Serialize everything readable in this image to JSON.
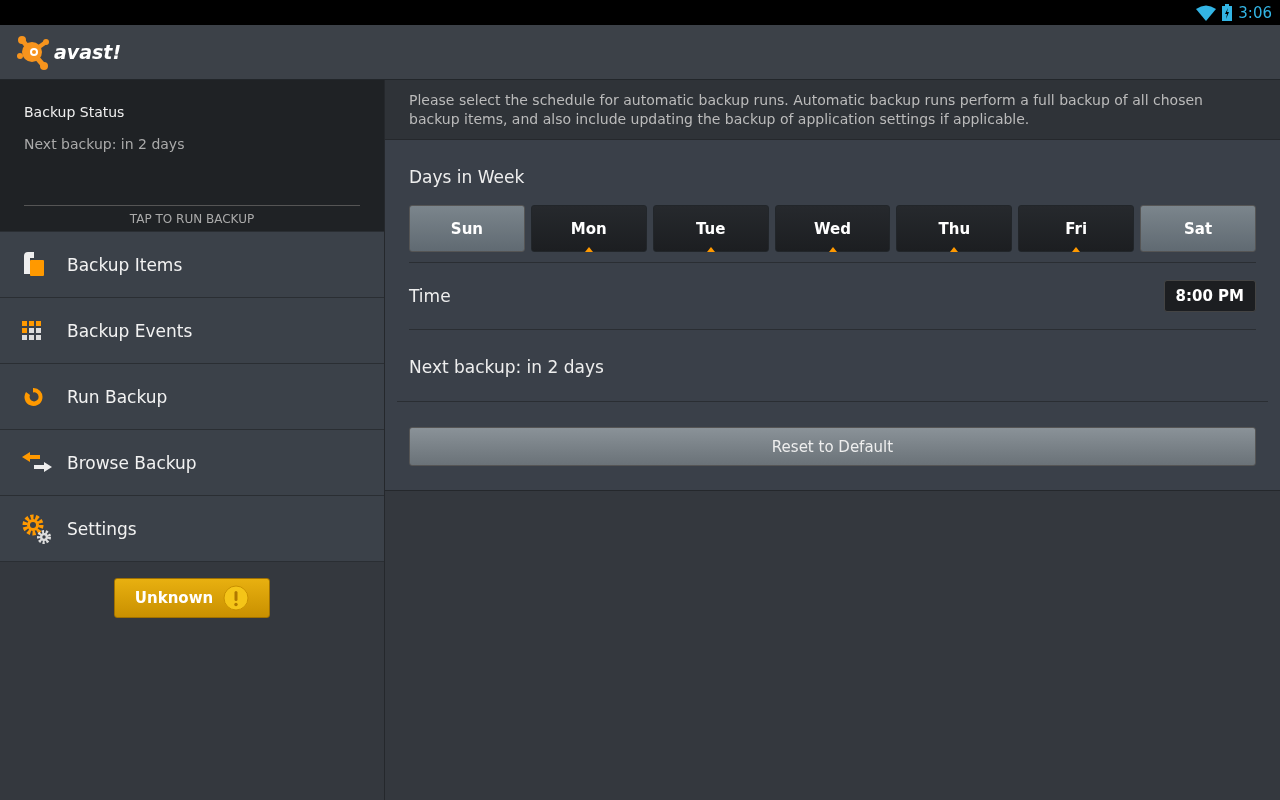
{
  "status_bar": {
    "time": "3:06"
  },
  "header": {
    "logo_text": "avast!"
  },
  "sidebar": {
    "status_title": "Backup Status",
    "status_text": "Next backup: in 2 days",
    "run_label": "TAP TO RUN BACKUP",
    "items": [
      {
        "label": "Backup Items",
        "kind": "items"
      },
      {
        "label": "Backup Events",
        "kind": "events"
      },
      {
        "label": "Run Backup",
        "kind": "run"
      },
      {
        "label": "Browse Backup",
        "kind": "browse"
      },
      {
        "label": "Settings",
        "kind": "settings"
      }
    ],
    "status_button": "Unknown"
  },
  "content": {
    "description": "Please select the schedule for automatic backup runs. Automatic backup runs perform a full backup of all chosen backup items, and also include updating the backup of application settings if applicable.",
    "days_title": "Days in Week",
    "days": [
      {
        "label": "Sun",
        "selected": false
      },
      {
        "label": "Mon",
        "selected": true
      },
      {
        "label": "Tue",
        "selected": true
      },
      {
        "label": "Wed",
        "selected": true
      },
      {
        "label": "Thu",
        "selected": true
      },
      {
        "label": "Fri",
        "selected": true
      },
      {
        "label": "Sat",
        "selected": false
      }
    ],
    "time_label": "Time",
    "time_value": "8:00 PM",
    "next_backup": "Next backup: in 2 days",
    "reset_button": "Reset to Default"
  }
}
